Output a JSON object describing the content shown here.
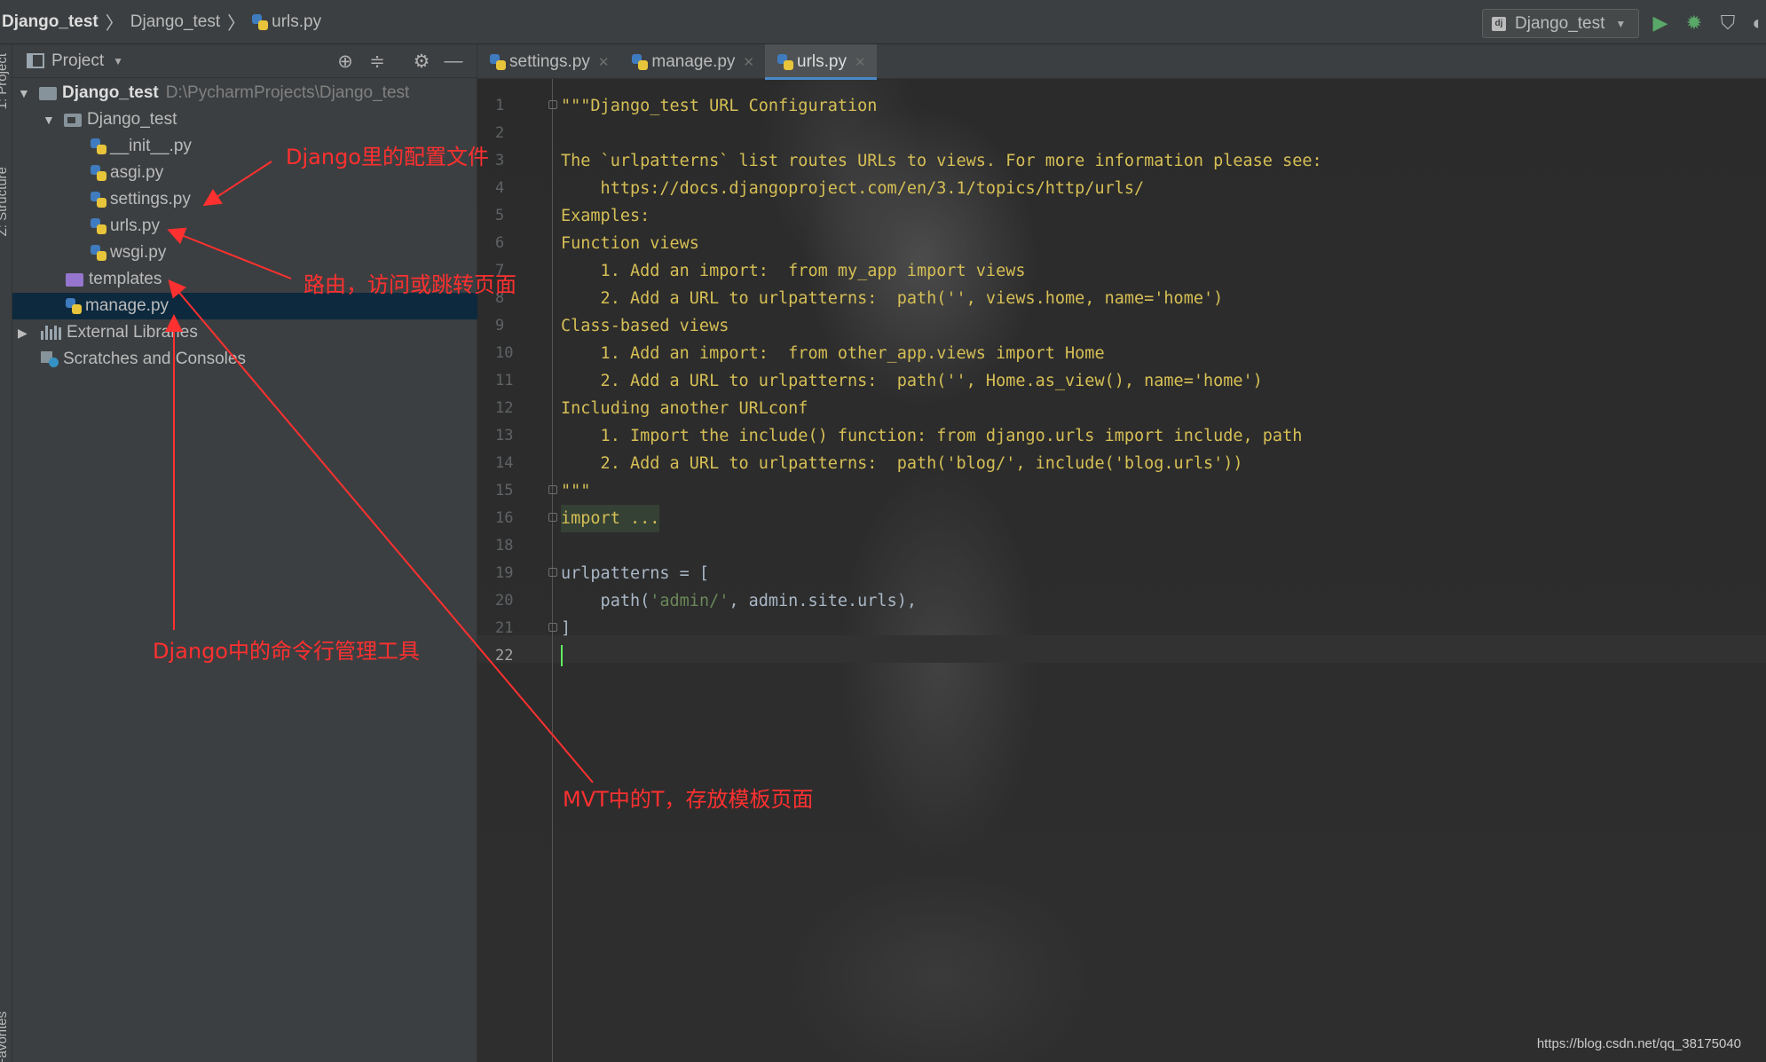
{
  "navbar": {
    "crumbs": [
      "Django_test",
      "Django_test",
      "urls.py"
    ],
    "run_config": "Django_test",
    "run_icon": "play-icon",
    "debug_icon": "bug-icon",
    "coverage_icon": "shield-run-icon"
  },
  "side_tabs": {
    "project": "1: Project",
    "structure": "Z: Structure",
    "favorites": "Favorites"
  },
  "project_panel": {
    "title": "Project",
    "tree": [
      {
        "label": "Django_test",
        "path": "D:\\PycharmProjects\\Django_test",
        "type": "root-folder"
      },
      {
        "label": "Django_test",
        "type": "module-folder"
      },
      {
        "label": "__init__.py",
        "type": "python-file"
      },
      {
        "label": "asgi.py",
        "type": "python-file"
      },
      {
        "label": "settings.py",
        "type": "python-file"
      },
      {
        "label": "urls.py",
        "type": "python-file"
      },
      {
        "label": "wsgi.py",
        "type": "python-file"
      },
      {
        "label": "templates",
        "type": "template-folder"
      },
      {
        "label": "manage.py",
        "type": "python-file",
        "selected": true
      },
      {
        "label": "External Libraries",
        "type": "libraries"
      },
      {
        "label": "Scratches and Consoles",
        "type": "scratches"
      }
    ]
  },
  "editor": {
    "tabs": [
      {
        "label": "settings.py",
        "active": false
      },
      {
        "label": "manage.py",
        "active": false
      },
      {
        "label": "urls.py",
        "active": true
      }
    ],
    "line_numbers": [
      "1",
      "2",
      "3",
      "4",
      "5",
      "6",
      "7",
      "8",
      "9",
      "10",
      "11",
      "12",
      "13",
      "14",
      "15",
      "16",
      "18",
      "19",
      "20",
      "21",
      "22"
    ],
    "lines": [
      "\"\"\"Django_test URL Configuration",
      "",
      "The `urlpatterns` list routes URLs to views. For more information please see:",
      "    https://docs.djangoproject.com/en/3.1/topics/http/urls/",
      "Examples:",
      "Function views",
      "    1. Add an import:  from my_app import views",
      "    2. Add a URL to urlpatterns:  path('', views.home, name='home')",
      "Class-based views",
      "    1. Add an import:  from other_app.views import Home",
      "    2. Add a URL to urlpatterns:  path('', Home.as_view(), name='home')",
      "Including another URLconf",
      "    1. Import the include() function: from django.urls import include, path",
      "    2. Add a URL to urlpatterns:  path('blog/', include('blog.urls'))",
      "\"\"\"",
      "import ...",
      "",
      "urlpatterns = [",
      "    path('admin/', admin.site.urls),",
      "]",
      ""
    ],
    "path_call_prefix": "    path(",
    "path_call_string": "'admin/'",
    "path_call_suffix": ", admin.site.urls),"
  },
  "annotations": {
    "settings_note": "Django里的配置文件",
    "urls_note": "路由，访问或跳转页面",
    "manage_note": "Django中的命令行管理工具",
    "templates_note": "MVT中的T，存放模板页面"
  },
  "watermark": "https://blog.csdn.net/qq_38175040",
  "colors": {
    "annotation": "#ff3030",
    "docstring": "#d6bf55",
    "string": "#6a8759",
    "caret": "#5ff05f",
    "selection": "#0d293e"
  }
}
